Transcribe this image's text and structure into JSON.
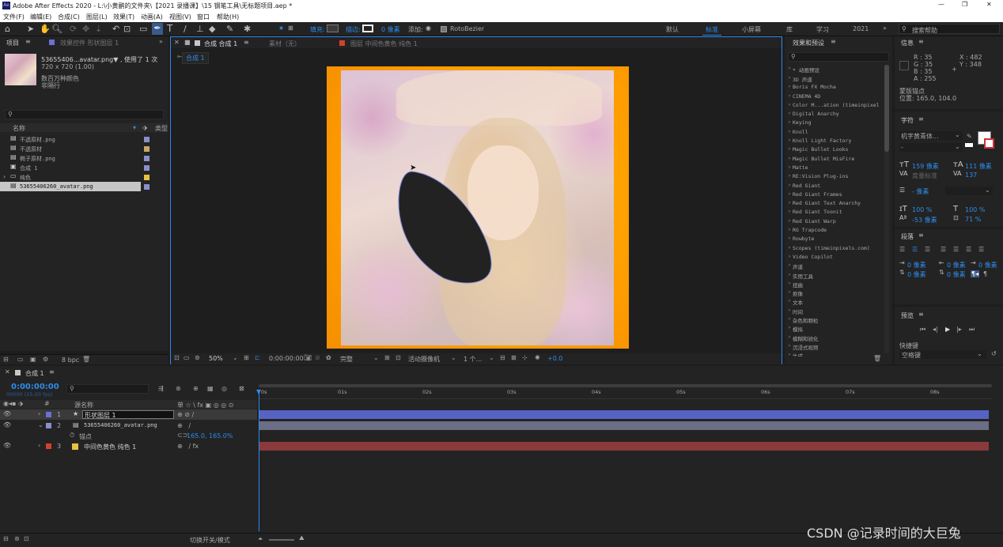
{
  "titlebar": {
    "app_title": "Adobe After Effects 2020 - L:\\小黄鹂的文件夹\\【2021 录播课】\\15 钢笔工具\\无标题项目.aep *",
    "min": "—",
    "max": "❐",
    "close": "✕"
  },
  "menu": [
    "文件(F)",
    "编辑(E)",
    "合成(C)",
    "图层(L)",
    "效果(T)",
    "动画(A)",
    "视图(V)",
    "窗口",
    "帮助(H)"
  ],
  "toolbar": {
    "fill_label": "填充:",
    "stroke_label": "描边:",
    "stroke_px": "0 像素",
    "add_label": "添加:",
    "rotobezier": "RotoBezier",
    "workspaces": [
      "默认",
      "标准",
      "小屏幕",
      "库",
      "学习",
      "2021"
    ],
    "active_workspace": "标准",
    "search_help": "搜索帮助"
  },
  "project": {
    "tab": "项目",
    "fx_tab": "效果控件 形状图层 1",
    "thumb_name": "53655406...avatar.png▼ , 使用了 1 次",
    "thumb_size": "720 x 720 (1.00)",
    "thumb_colors": "数百万种颜色",
    "thumb_alpha": "非隔行",
    "col_name": "名称",
    "col_type": "类型",
    "items": [
      {
        "name": "不透原材.png",
        "color": "#8a8fc9"
      },
      {
        "name": "不透原材",
        "color": "#c8a76a"
      },
      {
        "name": "椭子原材.png",
        "color": "#8a8fc9"
      },
      {
        "name": "合成 1",
        "color": "#8a8fc9"
      },
      {
        "name": "纯色",
        "color": "#e9c040"
      },
      {
        "name": "53655406260_avatar.png",
        "color": "#8a8fc9"
      }
    ],
    "bpc": "8 bpc"
  },
  "comp": {
    "tabs": [
      "合成 合成 1",
      "素材（无）",
      "图层 中间色黄色 纯色 1"
    ],
    "subtab": "合成 1",
    "zoom": "50%",
    "timecode": "0:00:00:00",
    "quality": "完整",
    "camera": "活动摄像机",
    "views": "1 个...",
    "exposure": "+0.0"
  },
  "effects": {
    "title": "效果和预设",
    "search_placeholder": "",
    "items": [
      "* 动画预设",
      "3D 声道",
      "Boris FX Mocha",
      "CINEMA 4D",
      "Color M...ation (timeinpixel",
      "Digital Anarchy",
      "Keying",
      "Knoll",
      "Knoll Light Factory",
      "Magic Bullet Looks",
      "Magic Bullet MisFire",
      "Matte",
      "RE:Vision Plug-ins",
      "Red Giant",
      "Red Giant Frames",
      "Red Giant Text Anarchy",
      "Red Giant Toonit",
      "Red Giant Warp",
      "RG Trapcode",
      "Rowbyte",
      "Scopes (timeinpixels.com)",
      "Video Copilot",
      "声道",
      "实用工具",
      "扭曲",
      "抠像",
      "文本",
      "时间",
      "杂色和颗粒",
      "模拟",
      "模糊和锐化",
      "沉浸式视频",
      "生成"
    ]
  },
  "info": {
    "title": "信息",
    "r": "R : 35",
    "g": "G : 35",
    "b": "B : 35",
    "a": "A : 255",
    "x": "X : 482",
    "y": "Y : 348",
    "anchor_title": "蒙版锚点",
    "anchor_pos": "位置: 165.0, 104.0"
  },
  "char": {
    "title": "字符",
    "font": "机字黄青体...",
    "style": "-",
    "size": "159 像素",
    "leading": "111 像素",
    "kerning": "度量标准",
    "tracking": "137",
    "stroke_w": "- 像素",
    "vscale": "100 %",
    "hscale": "100 %",
    "baseline": "-53 像素",
    "tsume": "71 %"
  },
  "para": {
    "title": "段落",
    "v1": "0 像素",
    "v2": "0 像素",
    "v3": "0 像素",
    "v4": "0 像素",
    "v5": "0 像素"
  },
  "preview": {
    "title": "预览",
    "shortcut_label": "快捷键",
    "shortcut": "空格键"
  },
  "timeline": {
    "tab": "合成 1",
    "timecode": "0:00:00:00",
    "fps": "00000 (25.00 fps)",
    "search_placeholder": "",
    "col_src": "源名称",
    "col_switches": "单 ☆ \\ fx ▣ ◎ ◎ ⊙",
    "ticks": [
      "0s",
      "01s",
      "02s",
      "03s",
      "04s",
      "05s",
      "06s",
      "07s",
      "08s"
    ],
    "layers": [
      {
        "num": "1",
        "name": "形状图层 1",
        "color": "#6b6fd6",
        "bar": "#5a66c8"
      },
      {
        "num": "2",
        "name": "53655406260_avatar.png",
        "color": "#8a8fc9",
        "bar": "#6c6e85"
      },
      {
        "num": "3",
        "name": "中间色黄色 纯色 1",
        "color": "#d4402e",
        "bar": "#8a3a3a"
      }
    ],
    "prop_name": "锚点",
    "prop_value": "165.0, 165.0%",
    "footer": "切换开关/模式"
  },
  "watermark": "CSDN @记录时间的大巨兔"
}
